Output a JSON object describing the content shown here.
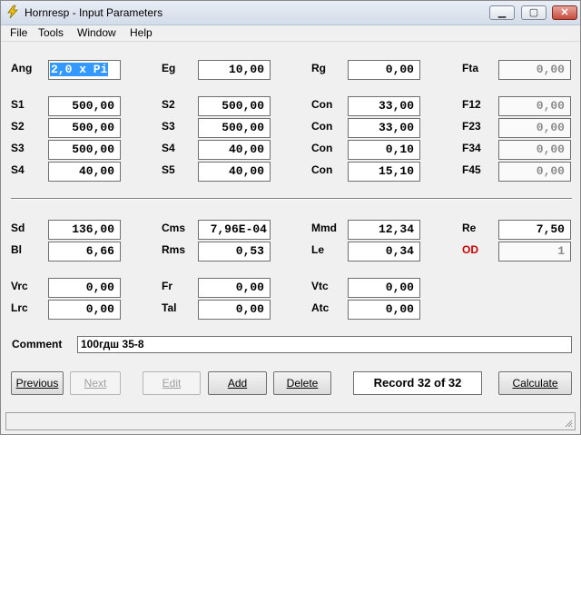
{
  "window": {
    "title": "Hornresp - Input Parameters"
  },
  "menu": [
    "File",
    "Tools",
    "Window",
    "Help"
  ],
  "params": {
    "ang": {
      "label": "Ang",
      "value": "2,0 x Pi"
    },
    "eg": {
      "label": "Eg",
      "value": "10,00"
    },
    "rg": {
      "label": "Rg",
      "value": "0,00"
    },
    "fta": {
      "label": "Fta",
      "value": "0,00"
    },
    "s1": {
      "label": "S1",
      "value": "500,00"
    },
    "s2a": {
      "label": "S2",
      "value": "500,00"
    },
    "s3a": {
      "label": "S3",
      "value": "500,00"
    },
    "s4a": {
      "label": "S4",
      "value": "40,00"
    },
    "s2b": {
      "label": "S2",
      "value": "500,00"
    },
    "s3b": {
      "label": "S3",
      "value": "500,00"
    },
    "s4b": {
      "label": "S4",
      "value": "40,00"
    },
    "s5": {
      "label": "S5",
      "value": "40,00"
    },
    "con1": {
      "label": "Con",
      "value": "33,00"
    },
    "con2": {
      "label": "Con",
      "value": "33,00"
    },
    "con3": {
      "label": "Con",
      "value": "0,10"
    },
    "con4": {
      "label": "Con",
      "value": "15,10"
    },
    "f12": {
      "label": "F12",
      "value": "0,00"
    },
    "f23": {
      "label": "F23",
      "value": "0,00"
    },
    "f34": {
      "label": "F34",
      "value": "0,00"
    },
    "f45": {
      "label": "F45",
      "value": "0,00"
    },
    "sd": {
      "label": "Sd",
      "value": "136,00"
    },
    "bl": {
      "label": "Bl",
      "value": "6,66"
    },
    "cms": {
      "label": "Cms",
      "value": "7,96E-04"
    },
    "rms": {
      "label": "Rms",
      "value": "0,53"
    },
    "mmd": {
      "label": "Mmd",
      "value": "12,34"
    },
    "le": {
      "label": "Le",
      "value": "0,34"
    },
    "re": {
      "label": "Re",
      "value": "7,50"
    },
    "od": {
      "label": "OD",
      "value": "1"
    },
    "vrc": {
      "label": "Vrc",
      "value": "0,00"
    },
    "lrc": {
      "label": "Lrc",
      "value": "0,00"
    },
    "fr": {
      "label": "Fr",
      "value": "0,00"
    },
    "tal": {
      "label": "Tal",
      "value": "0,00"
    },
    "vtc": {
      "label": "Vtc",
      "value": "0,00"
    },
    "atc": {
      "label": "Atc",
      "value": "0,00"
    }
  },
  "comment": {
    "label": "Comment",
    "value": "100гдш 35-8"
  },
  "buttons": {
    "previous": "Previous",
    "next": "Next",
    "edit": "Edit",
    "add": "Add",
    "delete": "Delete",
    "calculate": "Calculate"
  },
  "record": "Record 32 of 32",
  "icons": {
    "app": "lightning-icon",
    "minimize": "minimize-icon",
    "maximize": "maximize-icon",
    "close": "close-icon"
  },
  "colors": {
    "selection": "#3399ff",
    "od_label": "#cc0000"
  }
}
